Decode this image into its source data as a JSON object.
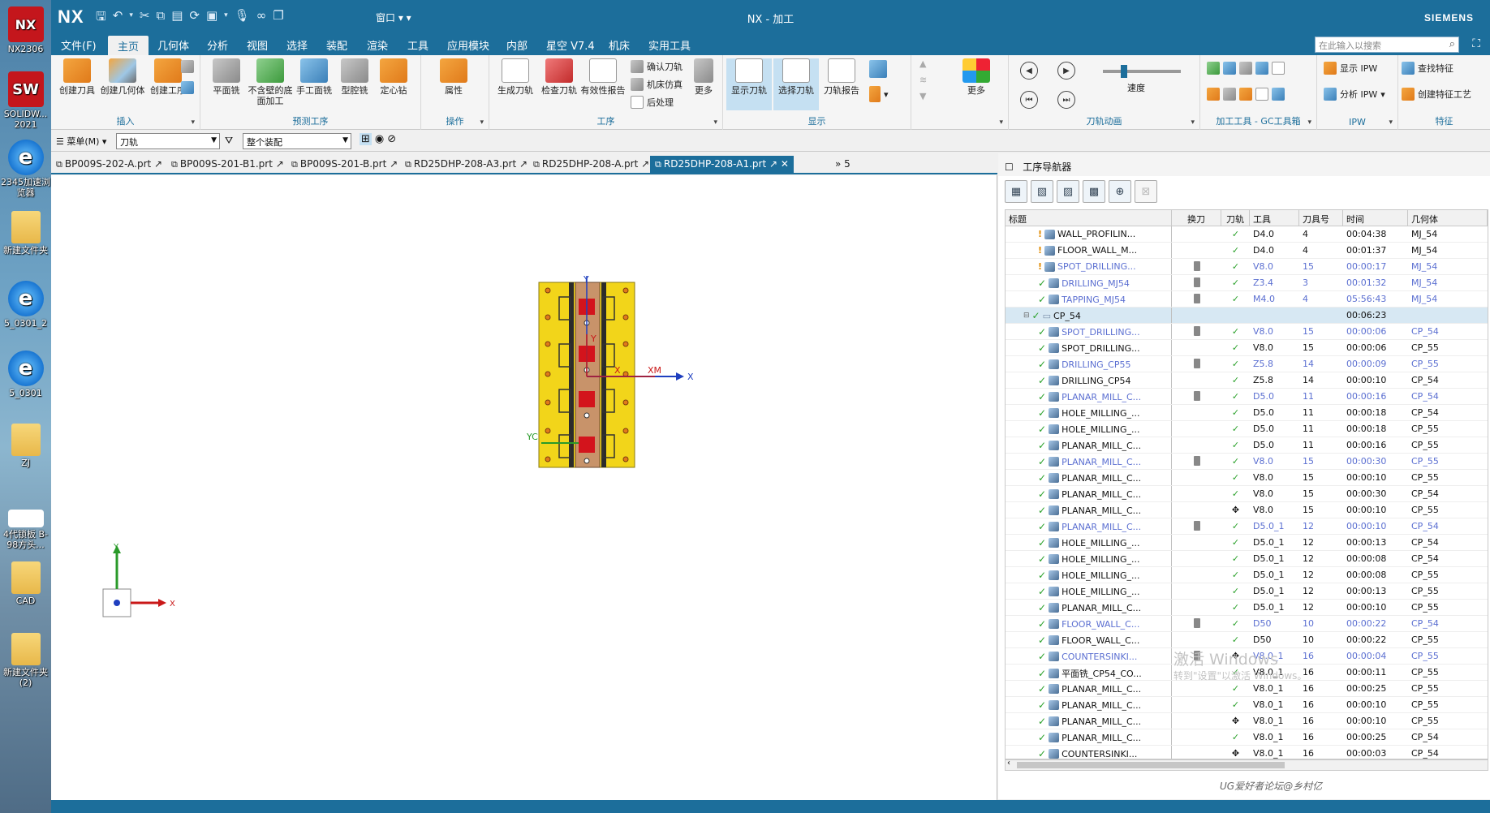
{
  "desktop": {
    "icons": [
      {
        "label": "NX2306",
        "glyph": "NX"
      },
      {
        "label": "SOLIDW... 2021",
        "glyph": "SW"
      },
      {
        "label": "2345加速浏览器",
        "glyph": "e"
      },
      {
        "label": "新建文件夹",
        "glyph": ""
      },
      {
        "label": "5_0301_2",
        "glyph": "e"
      },
      {
        "label": "5_0301",
        "glyph": "e"
      },
      {
        "label": "ZJ",
        "glyph": ""
      },
      {
        "label": "4代锁板 B-98方头...",
        "glyph": ""
      },
      {
        "label": "CAD",
        "glyph": ""
      },
      {
        "label": "新建文件夹 (2)",
        "glyph": ""
      }
    ]
  },
  "titlebar": {
    "logo": "NX",
    "window_menu": "窗口",
    "title": "NX - 加工",
    "brand": "SIEMENS"
  },
  "menubar": {
    "items": [
      "文件(F)",
      "主页",
      "几何体",
      "分析",
      "视图",
      "选择",
      "装配",
      "渲染",
      "工具",
      "应用模块",
      "内部",
      "星空 V7.4",
      "机床",
      "实用工具"
    ],
    "active_index": 1,
    "search_placeholder": "在此输入以搜索"
  },
  "ribbon": {
    "groups": [
      {
        "title": "插入",
        "buttons": [
          "创建刀具",
          "创建几何体",
          "创建工序"
        ]
      },
      {
        "title": "预测工序",
        "buttons": [
          "平面铣",
          "不含壁的底面加工",
          "手工面铣",
          "型腔铣",
          "定心钻"
        ]
      },
      {
        "title": "操作",
        "buttons": [
          "属性"
        ]
      },
      {
        "title": "工序",
        "buttons": [
          "生成刀轨",
          "检查刀轨",
          "有效性报告",
          "更多"
        ],
        "small": [
          "确认刀轨",
          "机床仿真",
          "后处理"
        ]
      },
      {
        "title": "显示",
        "buttons": [
          "显示刀轨",
          "选择刀轨",
          "刀轨报告",
          "更多"
        ]
      },
      {
        "title": "刀轨动画",
        "speed_label": "速度"
      },
      {
        "title": "加工工具 - GC工具箱"
      },
      {
        "title": "IPW",
        "small": [
          "显示 IPW",
          "分析 IPW"
        ]
      },
      {
        "title": "特征",
        "small": [
          "查找特征",
          "创建特征工艺"
        ],
        "buttons": [
          "更多"
        ]
      }
    ]
  },
  "selbar": {
    "menu_label": "菜单(M)",
    "filter_value": "刀轨",
    "scope_value": "整个装配"
  },
  "file_tabs": {
    "tabs": [
      "BP009S-202-A.prt",
      "BP009S-201-B1.prt",
      "BP009S-201-B.prt",
      "RD25DHP-208-A3.prt",
      "RD25DHP-208-A.prt",
      "RD25DHP-208-A1.prt"
    ],
    "active_index": 5,
    "overflow": "5"
  },
  "viewport": {
    "axis_labels": {
      "y_top": "Y",
      "x_right": "X",
      "xm": "XM",
      "yc": "YC",
      "y_inner": "Y",
      "x_inner": "X",
      "triad_x": "X",
      "triad_y": "Y"
    }
  },
  "navigator": {
    "title": "工序导航器",
    "columns": [
      "标题",
      "换刀",
      "刀轨",
      "工具",
      "刀具号",
      "时间",
      "几何体"
    ],
    "rows": [
      {
        "name": "WALL_PROFILIN...",
        "state": "warn",
        "tc": false,
        "path": "check",
        "tool": "D4.0",
        "num": "4",
        "time": "00:04:38",
        "geom": "MJ_54",
        "blue": false,
        "level": 2
      },
      {
        "name": "FLOOR_WALL_M...",
        "state": "warn",
        "tc": false,
        "path": "check",
        "tool": "D4.0",
        "num": "4",
        "time": "00:01:37",
        "geom": "MJ_54",
        "blue": false,
        "level": 2
      },
      {
        "name": "SPOT_DRILLING...",
        "state": "warn",
        "tc": true,
        "path": "check",
        "tool": "V8.0",
        "num": "15",
        "time": "00:00:17",
        "geom": "MJ_54",
        "blue": true,
        "level": 2
      },
      {
        "name": "DRILLING_MJ54",
        "state": "ok",
        "tc": true,
        "path": "check",
        "tool": "Z3.4",
        "num": "3",
        "time": "00:01:32",
        "geom": "MJ_54",
        "blue": true,
        "level": 2
      },
      {
        "name": "TAPPING_MJ54",
        "state": "ok",
        "tc": true,
        "path": "check",
        "tool": "M4.0",
        "num": "4",
        "time": "05:56:43",
        "geom": "MJ_54",
        "blue": true,
        "level": 2
      },
      {
        "name": "CP_54",
        "state": "ok",
        "tc": false,
        "path": "",
        "tool": "",
        "num": "",
        "time": "00:06:23",
        "geom": "",
        "blue": false,
        "level": 1,
        "group": true
      },
      {
        "name": "SPOT_DRILLING...",
        "state": "ok",
        "tc": true,
        "path": "check",
        "tool": "V8.0",
        "num": "15",
        "time": "00:00:06",
        "geom": "CP_54",
        "blue": true,
        "level": 2
      },
      {
        "name": "SPOT_DRILLING...",
        "state": "ok",
        "tc": false,
        "path": "check",
        "tool": "V8.0",
        "num": "15",
        "time": "00:00:06",
        "geom": "CP_55",
        "blue": false,
        "level": 2
      },
      {
        "name": "DRILLING_CP55",
        "state": "ok",
        "tc": true,
        "path": "check",
        "tool": "Z5.8",
        "num": "14",
        "time": "00:00:09",
        "geom": "CP_55",
        "blue": true,
        "level": 2
      },
      {
        "name": "DRILLING_CP54",
        "state": "ok",
        "tc": false,
        "path": "check",
        "tool": "Z5.8",
        "num": "14",
        "time": "00:00:10",
        "geom": "CP_54",
        "blue": false,
        "level": 2
      },
      {
        "name": "PLANAR_MILL_C...",
        "state": "ok",
        "tc": true,
        "path": "check",
        "tool": "D5.0",
        "num": "11",
        "time": "00:00:16",
        "geom": "CP_54",
        "blue": true,
        "level": 2
      },
      {
        "name": "HOLE_MILLING_...",
        "state": "ok",
        "tc": false,
        "path": "check",
        "tool": "D5.0",
        "num": "11",
        "time": "00:00:18",
        "geom": "CP_54",
        "blue": false,
        "level": 2
      },
      {
        "name": "HOLE_MILLING_...",
        "state": "ok",
        "tc": false,
        "path": "check",
        "tool": "D5.0",
        "num": "11",
        "time": "00:00:18",
        "geom": "CP_55",
        "blue": false,
        "level": 2
      },
      {
        "name": "PLANAR_MILL_C...",
        "state": "ok",
        "tc": false,
        "path": "check",
        "tool": "D5.0",
        "num": "11",
        "time": "00:00:16",
        "geom": "CP_55",
        "blue": false,
        "level": 2
      },
      {
        "name": "PLANAR_MILL_C...",
        "state": "ok",
        "tc": true,
        "path": "check",
        "tool": "V8.0",
        "num": "15",
        "time": "00:00:30",
        "geom": "CP_55",
        "blue": true,
        "level": 2
      },
      {
        "name": "PLANAR_MILL_C...",
        "state": "ok",
        "tc": false,
        "path": "check",
        "tool": "V8.0",
        "num": "15",
        "time": "00:00:10",
        "geom": "CP_55",
        "blue": false,
        "level": 2
      },
      {
        "name": "PLANAR_MILL_C...",
        "state": "ok",
        "tc": false,
        "path": "check",
        "tool": "V8.0",
        "num": "15",
        "time": "00:00:30",
        "geom": "CP_54",
        "blue": false,
        "level": 2
      },
      {
        "name": "PLANAR_MILL_C...",
        "state": "ok",
        "tc": false,
        "path": "move",
        "tool": "V8.0",
        "num": "15",
        "time": "00:00:10",
        "geom": "CP_55",
        "blue": false,
        "level": 2
      },
      {
        "name": "PLANAR_MILL_C...",
        "state": "ok",
        "tc": true,
        "path": "check",
        "tool": "D5.0_1",
        "num": "12",
        "time": "00:00:10",
        "geom": "CP_54",
        "blue": true,
        "level": 2
      },
      {
        "name": "HOLE_MILLING_...",
        "state": "ok",
        "tc": false,
        "path": "check",
        "tool": "D5.0_1",
        "num": "12",
        "time": "00:00:13",
        "geom": "CP_54",
        "blue": false,
        "level": 2
      },
      {
        "name": "HOLE_MILLING_...",
        "state": "ok",
        "tc": false,
        "path": "check",
        "tool": "D5.0_1",
        "num": "12",
        "time": "00:00:08",
        "geom": "CP_54",
        "blue": false,
        "level": 2
      },
      {
        "name": "HOLE_MILLING_...",
        "state": "ok",
        "tc": false,
        "path": "check",
        "tool": "D5.0_1",
        "num": "12",
        "time": "00:00:08",
        "geom": "CP_55",
        "blue": false,
        "level": 2
      },
      {
        "name": "HOLE_MILLING_...",
        "state": "ok",
        "tc": false,
        "path": "check",
        "tool": "D5.0_1",
        "num": "12",
        "time": "00:00:13",
        "geom": "CP_55",
        "blue": false,
        "level": 2
      },
      {
        "name": "PLANAR_MILL_C...",
        "state": "ok",
        "tc": false,
        "path": "check",
        "tool": "D5.0_1",
        "num": "12",
        "time": "00:00:10",
        "geom": "CP_55",
        "blue": false,
        "level": 2
      },
      {
        "name": "FLOOR_WALL_C...",
        "state": "ok",
        "tc": true,
        "path": "check",
        "tool": "D50",
        "num": "10",
        "time": "00:00:22",
        "geom": "CP_54",
        "blue": true,
        "level": 2
      },
      {
        "name": "FLOOR_WALL_C...",
        "state": "ok",
        "tc": false,
        "path": "check",
        "tool": "D50",
        "num": "10",
        "time": "00:00:22",
        "geom": "CP_55",
        "blue": false,
        "level": 2
      },
      {
        "name": "COUNTERSINKI...",
        "state": "ok",
        "tc": true,
        "path": "move",
        "tool": "V8.0_1",
        "num": "16",
        "time": "00:00:04",
        "geom": "CP_55",
        "blue": true,
        "level": 2
      },
      {
        "name": "平面铣_CP54_CO...",
        "state": "ok",
        "tc": false,
        "path": "check",
        "tool": "V8.0_1",
        "num": "16",
        "time": "00:00:11",
        "geom": "CP_55",
        "blue": false,
        "level": 2
      },
      {
        "name": "PLANAR_MILL_C...",
        "state": "ok",
        "tc": false,
        "path": "check",
        "tool": "V8.0_1",
        "num": "16",
        "time": "00:00:25",
        "geom": "CP_55",
        "blue": false,
        "level": 2
      },
      {
        "name": "PLANAR_MILL_C...",
        "state": "ok",
        "tc": false,
        "path": "check",
        "tool": "V8.0_1",
        "num": "16",
        "time": "00:00:10",
        "geom": "CP_55",
        "blue": false,
        "level": 2
      },
      {
        "name": "PLANAR_MILL_C...",
        "state": "ok",
        "tc": false,
        "path": "move",
        "tool": "V8.0_1",
        "num": "16",
        "time": "00:00:10",
        "geom": "CP_55",
        "blue": false,
        "level": 2
      },
      {
        "name": "PLANAR_MILL_C...",
        "state": "ok",
        "tc": false,
        "path": "check",
        "tool": "V8.0_1",
        "num": "16",
        "time": "00:00:25",
        "geom": "CP_54",
        "blue": false,
        "level": 2
      },
      {
        "name": "COUNTERSINKI...",
        "state": "ok",
        "tc": false,
        "path": "move",
        "tool": "V8.0_1",
        "num": "16",
        "time": "00:00:03",
        "geom": "CP_54",
        "blue": false,
        "level": 2
      }
    ]
  },
  "watermark": {
    "line1": "激活 Windows",
    "line2": "转到\"设置\"以激活 Windows。",
    "line3": "UG爱好者论坛@乡村亿"
  }
}
